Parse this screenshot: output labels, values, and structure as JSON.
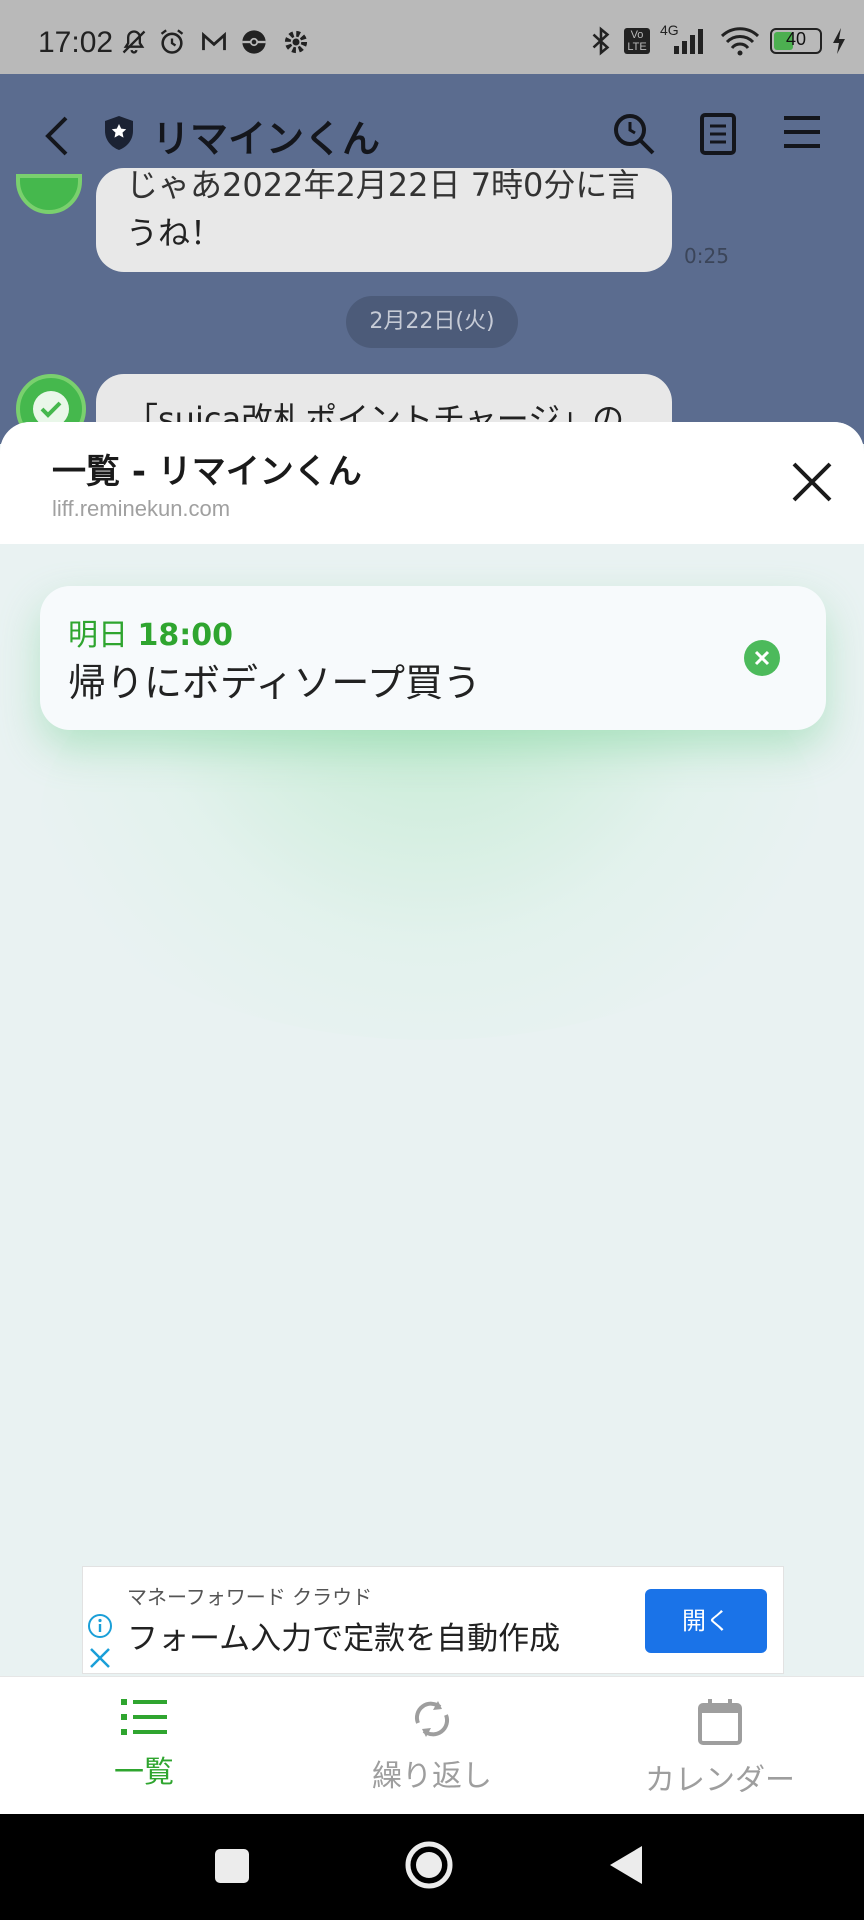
{
  "status_bar": {
    "time": "17:02",
    "battery": "40",
    "network": "4G",
    "volte": "Vo LTE"
  },
  "chat": {
    "title": "リマインくん",
    "message_partial_1": "じゃあ2022年2月22日 7時0分に言",
    "message_partial_2": "うね！",
    "time": "0:25",
    "date_separator": "2月22日(火)",
    "message_partial_3": "「suica改札ポイントチャージ」の"
  },
  "panel": {
    "title": "一覧 - リマインくん",
    "url": "liff.reminekun.com"
  },
  "reminder": {
    "when_day": "明日",
    "when_time": "18:00",
    "text": "帰りにボディソープ買う"
  },
  "ad": {
    "brand": "マネーフォワード クラウド",
    "copy": "フォーム入力で定款を自動作成",
    "button": "開く"
  },
  "bottom_nav": [
    {
      "label": "一覧",
      "icon": "list-icon",
      "active": true
    },
    {
      "label": "繰り返し",
      "icon": "repeat-icon",
      "active": false
    },
    {
      "label": "カレンダー",
      "icon": "calendar-icon",
      "active": false
    }
  ],
  "colors": {
    "accent_green": "#2fa52f",
    "chat_bg": "#5b6c8f",
    "ad_button": "#1a73e8"
  }
}
